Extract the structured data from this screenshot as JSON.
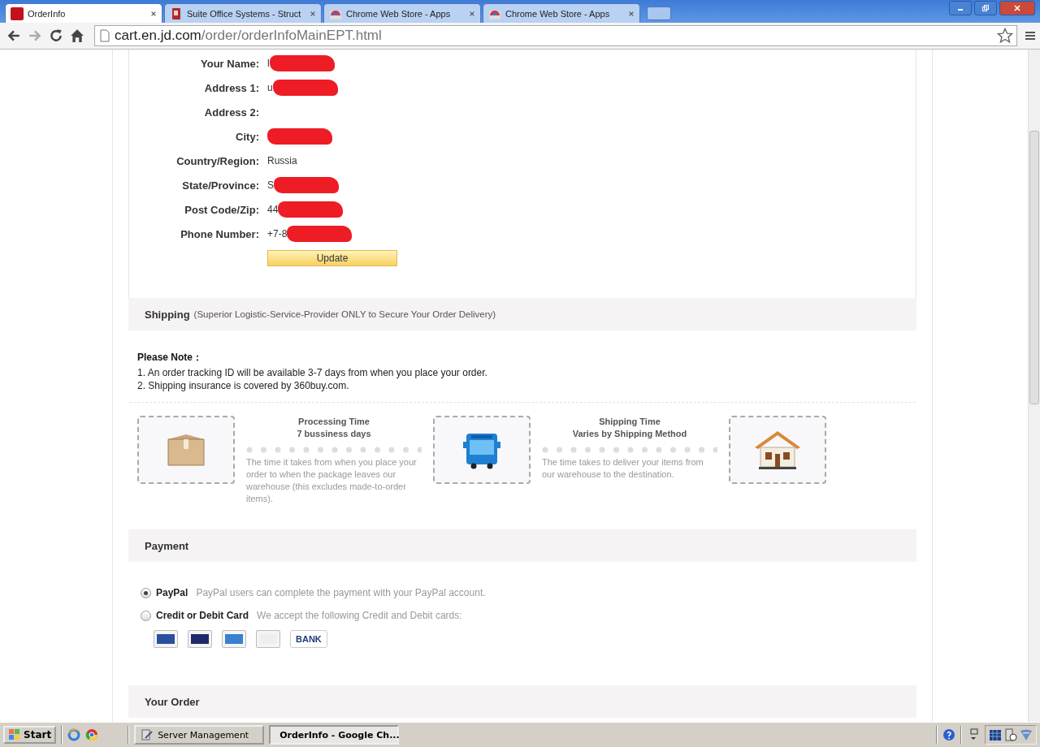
{
  "browser": {
    "tabs": [
      {
        "title": "OrderInfo",
        "selected": true
      },
      {
        "title": "Suite Office Systems - Struct",
        "selected": false
      },
      {
        "title": "Chrome Web Store - Apps",
        "selected": false
      },
      {
        "title": "Chrome Web Store - Apps",
        "selected": false
      }
    ],
    "address": {
      "host": "cart.en.jd.com",
      "path": "/order/orderInfoMainEPT.html"
    }
  },
  "address_form": {
    "fields": [
      {
        "label": "Your Name:",
        "value": "l",
        "redacted": true
      },
      {
        "label": "Address 1:",
        "value": "u",
        "redacted": true
      },
      {
        "label": "Address 2:"
      },
      {
        "label": "City:",
        "redacted": true
      },
      {
        "label": "Country/Region:",
        "value": "Russia"
      },
      {
        "label": "State/Province:",
        "value": "S",
        "redacted": true
      },
      {
        "label": "Post Code/Zip:",
        "value": "44",
        "redacted": true
      },
      {
        "label": "Phone Number:",
        "value": "+7-8",
        "redacted": true
      }
    ],
    "button": "Update"
  },
  "shipping": {
    "title": "Shipping",
    "subtitle": "(Superior Logistic-Service-Provider ONLY to Secure Your Order Delivery)",
    "note_title": "Please Note：",
    "notes": [
      "1. An order tracking ID will be available 3-7 days from when you place your order.",
      "2. Shipping insurance is covered by 360buy.com."
    ],
    "steps": [
      {
        "title": "Processing Time",
        "subtitle": "7 bussiness days",
        "description": "The time it takes from when you place your order to when the package leaves our warehouse (this excludes made-to-order items)."
      },
      {
        "title": "Shipping Time",
        "subtitle": "Varies by Shipping Method",
        "description": "The time takes to deliver your items from our warehouse to the destination."
      }
    ]
  },
  "payment": {
    "title": "Payment",
    "options": [
      {
        "label": "PayPal",
        "description": "PayPal users can complete the payment with your PayPal account.",
        "selected": true
      },
      {
        "label": "Credit or Debit Card",
        "description": "We accept the following Credit and Debit cards:",
        "selected": false
      }
    ],
    "cards": [
      {
        "kind": "visa"
      },
      {
        "kind": "mastercard"
      },
      {
        "kind": "amex"
      },
      {
        "kind": "discover"
      },
      {
        "kind": "bank",
        "label": "BANK"
      }
    ]
  },
  "order": {
    "title": "Your Order"
  },
  "taskbar": {
    "start": "Start",
    "tasks": [
      {
        "label": "Server Management",
        "selected": false
      },
      {
        "label": "OrderInfo - Google Ch...",
        "selected": true
      }
    ]
  }
}
